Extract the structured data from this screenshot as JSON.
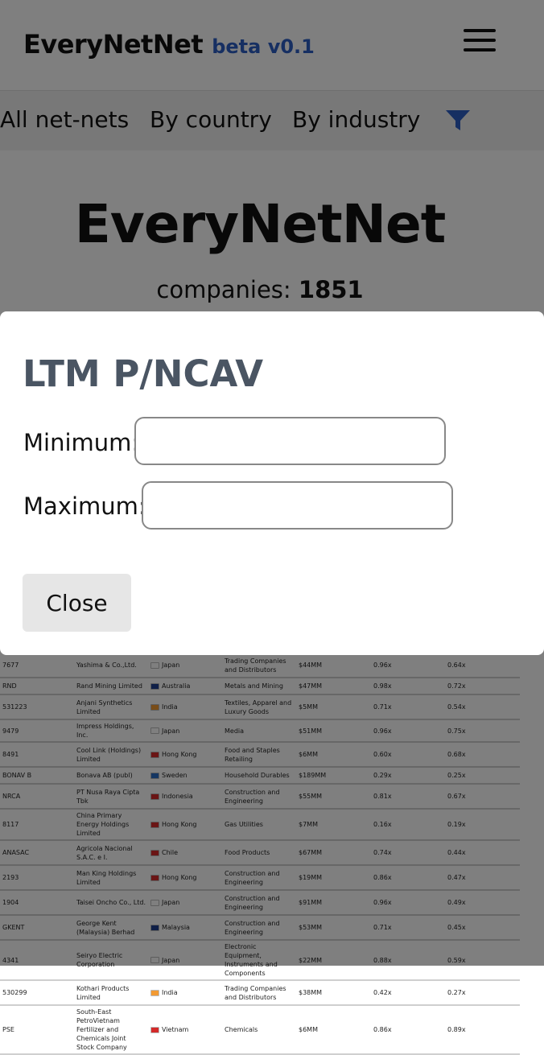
{
  "header": {
    "brand": "EveryNetNet",
    "beta": "beta v0.1"
  },
  "nav": {
    "all": "All net-nets",
    "country": "By country",
    "industry": "By industry"
  },
  "hero": {
    "title": "EveryNetNet",
    "count_label": "companies:",
    "count_value": "1851"
  },
  "modal": {
    "title": "LTM P/NCAV",
    "min_label": "Minimum:",
    "max_label": "Maximum:",
    "min_value": "",
    "max_value": "",
    "close_label": "Close"
  },
  "colors": {
    "accent": "#2d5fc4",
    "modal_title": "#4a5563"
  },
  "table": {
    "rows": [
      {
        "ticker": "7677",
        "name": "Yashima & Co.,Ltd.",
        "country": "Japan",
        "flag": "#ffffff",
        "industry": "Trading Companies and Distributors",
        "cap": "$44MM",
        "a": "0.96x",
        "b": "0.64x",
        "h": "r1"
      },
      {
        "ticker": "RND",
        "name": "Rand Mining Limited",
        "country": "Australia",
        "flag": "#1f3f8f",
        "industry": "Metals and Mining",
        "cap": "$47MM",
        "a": "0.98x",
        "b": "0.72x",
        "h": "r2"
      },
      {
        "ticker": "531223",
        "name": "Anjani Synthetics Limited",
        "country": "India",
        "flag": "#f29a33",
        "industry": "Textiles, Apparel and Luxury Goods",
        "cap": "$5MM",
        "a": "0.71x",
        "b": "0.54x",
        "h": "r1"
      },
      {
        "ticker": "9479",
        "name": "Impress Holdings, Inc.",
        "country": "Japan",
        "flag": "#ffffff",
        "industry": "Media",
        "cap": "$51MM",
        "a": "0.96x",
        "b": "0.75x",
        "h": "r2"
      },
      {
        "ticker": "8491",
        "name": "Cool Link (Holdings) Limited",
        "country": "Hong Kong",
        "flag": "#d42a2a",
        "industry": "Food and Staples Retailing",
        "cap": "$6MM",
        "a": "0.60x",
        "b": "0.68x",
        "h": "r1"
      },
      {
        "ticker": "BONAV B",
        "name": "Bonava AB (publ)",
        "country": "Sweden",
        "flag": "#2a6cc4",
        "industry": "Household Durables",
        "cap": "$189MM",
        "a": "0.29x",
        "b": "0.25x",
        "h": "r2"
      },
      {
        "ticker": "NRCA",
        "name": "PT Nusa Raya Cipta Tbk",
        "country": "Indonesia",
        "flag": "#d42a2a",
        "industry": "Construction and Engineering",
        "cap": "$55MM",
        "a": "0.81x",
        "b": "0.67x",
        "h": "r1"
      },
      {
        "ticker": "8117",
        "name": "China Primary Energy Holdings Limited",
        "country": "Hong Kong",
        "flag": "#d42a2a",
        "industry": "Gas Utilities",
        "cap": "$7MM",
        "a": "0.16x",
        "b": "0.19x",
        "h": "r1"
      },
      {
        "ticker": "ANASAC",
        "name": "Agricola Nacional S.A.C. e I.",
        "country": "Chile",
        "flag": "#d42a2a",
        "industry": "Food Products",
        "cap": "$67MM",
        "a": "0.74x",
        "b": "0.44x",
        "h": "r1"
      },
      {
        "ticker": "2193",
        "name": "Man King Holdings Limited",
        "country": "Hong Kong",
        "flag": "#d42a2a",
        "industry": "Construction and Engineering",
        "cap": "$19MM",
        "a": "0.86x",
        "b": "0.47x",
        "h": "r1"
      },
      {
        "ticker": "1904",
        "name": "Taisei Oncho Co., Ltd.",
        "country": "Japan",
        "flag": "#ffffff",
        "industry": "Construction and Engineering",
        "cap": "$91MM",
        "a": "0.96x",
        "b": "0.49x",
        "h": "r1"
      },
      {
        "ticker": "GKENT",
        "name": "George Kent (Malaysia) Berhad",
        "country": "Malaysia",
        "flag": "#1f3f8f",
        "industry": "Construction and Engineering",
        "cap": "$53MM",
        "a": "0.71x",
        "b": "0.45x",
        "h": "r1"
      },
      {
        "ticker": "4341",
        "name": "Seiryo Electric Corporation",
        "country": "Japan",
        "flag": "#ffffff",
        "industry": "Electronic Equipment, Instruments and Components",
        "cap": "$22MM",
        "a": "0.88x",
        "b": "0.59x",
        "h": "r3"
      },
      {
        "ticker": "530299",
        "name": "Kothari Products Limited",
        "country": "India",
        "flag": "#f29a33",
        "industry": "Trading Companies and Distributors",
        "cap": "$38MM",
        "a": "0.42x",
        "b": "0.27x",
        "h": "r1"
      },
      {
        "ticker": "PSE",
        "name": "South-East PetroVietnam Fertilizer and Chemicals Joint Stock Company",
        "country": "Vietnam",
        "flag": "#d42a2a",
        "industry": "Chemicals",
        "cap": "$6MM",
        "a": "0.86x",
        "b": "0.89x",
        "h": "r3"
      }
    ]
  }
}
